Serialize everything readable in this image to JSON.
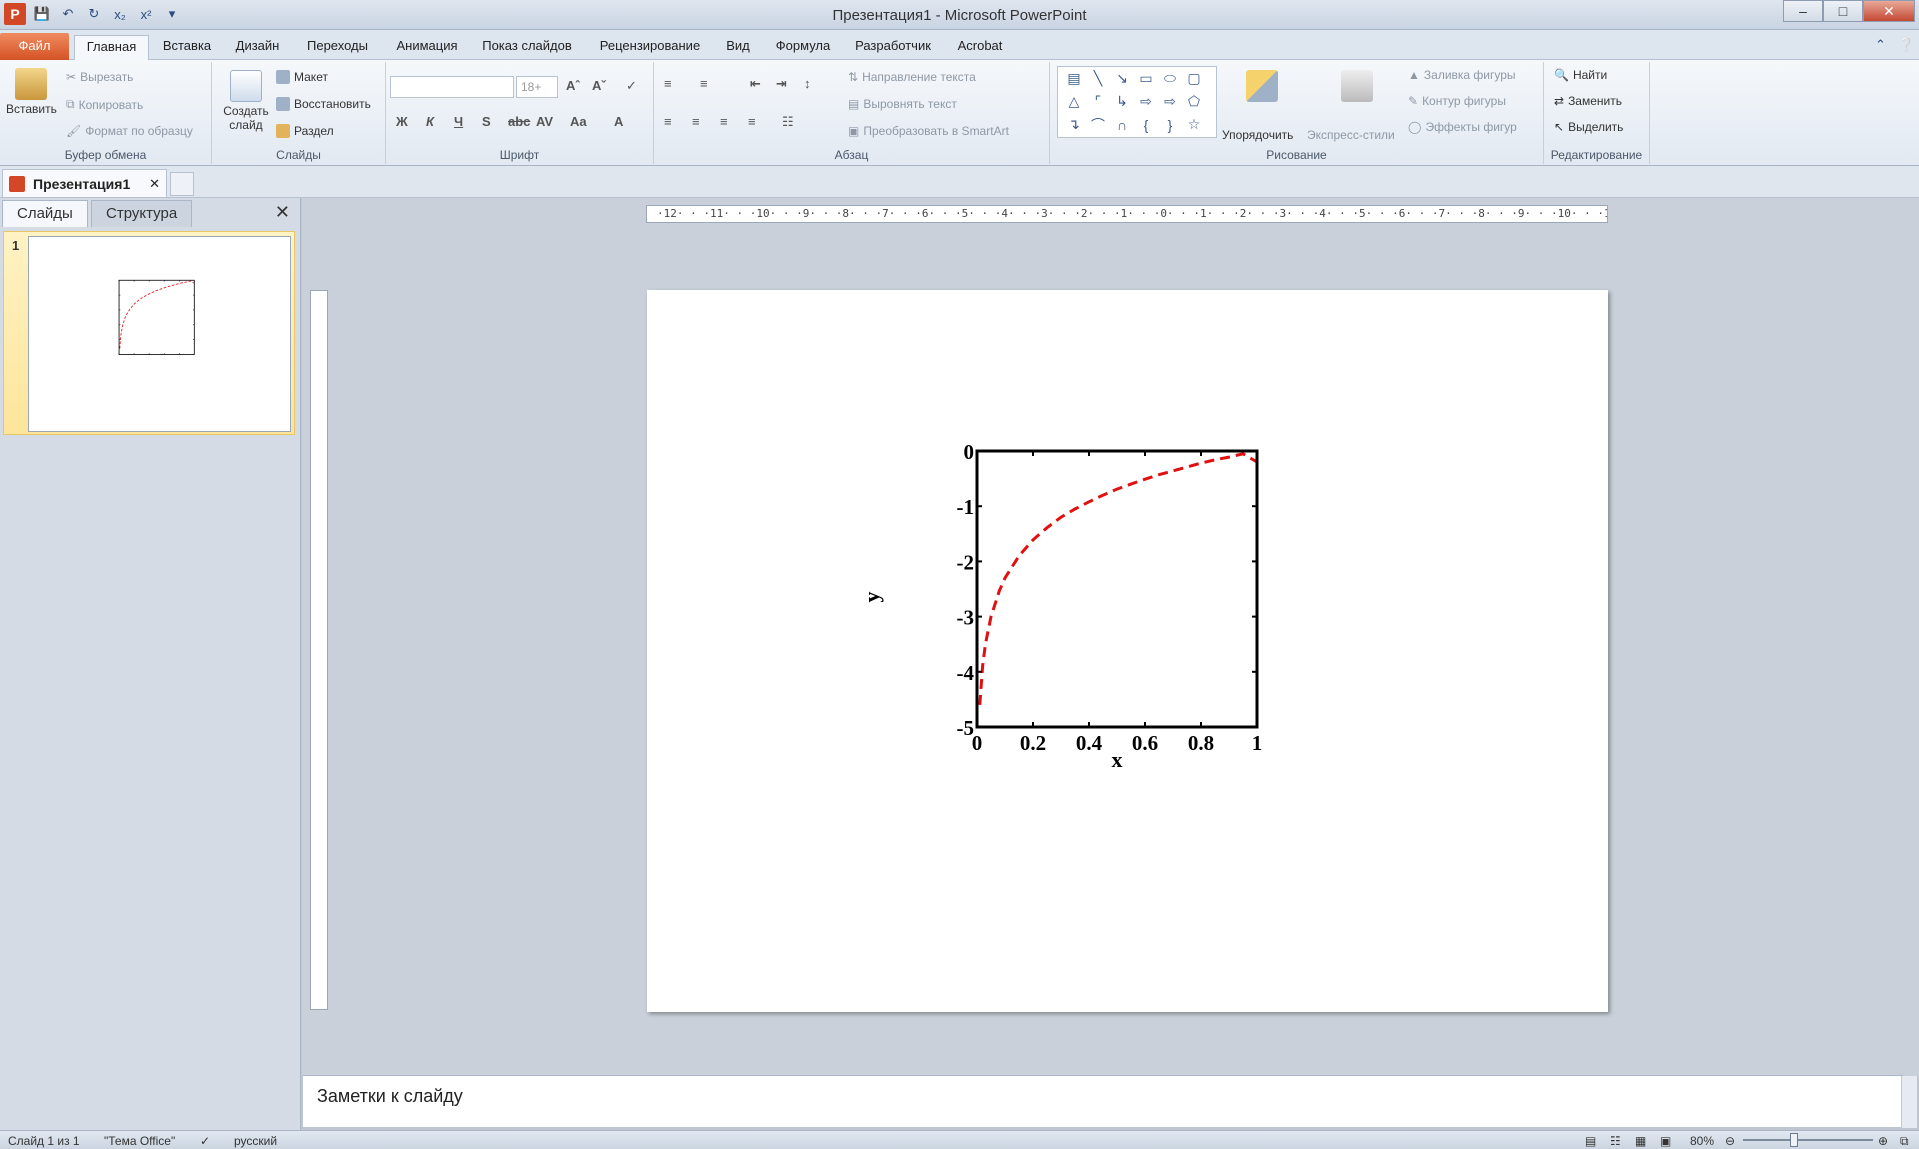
{
  "window": {
    "title": "Презентация1  -  Microsoft PowerPoint"
  },
  "tabs": [
    {
      "label": "Файл"
    },
    {
      "label": "Главная"
    },
    {
      "label": "Вставка"
    },
    {
      "label": "Дизайн"
    },
    {
      "label": "Переходы"
    },
    {
      "label": "Анимация"
    },
    {
      "label": "Показ слайдов"
    },
    {
      "label": "Рецензирование"
    },
    {
      "label": "Вид"
    },
    {
      "label": "Формула"
    },
    {
      "label": "Разработчик"
    },
    {
      "label": "Acrobat"
    }
  ],
  "ribbon": {
    "clipboard": {
      "label": "Буфер обмена",
      "paste": "Вставить",
      "cut": "Вырезать",
      "copy": "Копировать",
      "format": "Формат по образцу"
    },
    "slides": {
      "label": "Слайды",
      "new_slide": "Создать слайд",
      "layout": "Макет",
      "reset": "Восстановить",
      "section": "Раздел"
    },
    "font": {
      "label": "Шрифт",
      "size": "18+"
    },
    "paragraph": {
      "label": "Абзац",
      "text_direction": "Направление текста",
      "align_text": "Выровнять текст",
      "smartart": "Преобразовать в SmartArt"
    },
    "drawing": {
      "label": "Рисование",
      "arrange": "Упорядочить",
      "quick_styles": "Экспресс-стили",
      "fill": "Заливка фигуры",
      "outline": "Контур фигуры",
      "effects": "Эффекты фигур"
    },
    "editing": {
      "label": "Редактирование",
      "find": "Найти",
      "replace": "Заменить",
      "select": "Выделить"
    }
  },
  "document_tab": {
    "name": "Презентация1"
  },
  "left_panel": {
    "tab_slides": "Слайды",
    "tab_outline": "Структура",
    "slide_number": "1"
  },
  "ruler": {
    "horizontal": "·12· · ·11· · ·10· · ·9· · ·8· · ·7· · ·6· · ·5· · ·4· · ·3· · ·2· · ·1· · ·0· · ·1· · ·2· · ·3· · ·4· · ·5· · ·6· · ·7· · ·8· · ·9· · ·10· · ·11· · ·12·"
  },
  "chart_data": {
    "type": "line",
    "xlabel": "x",
    "ylabel": "y",
    "xlim": [
      0,
      1
    ],
    "ylim": [
      -5,
      0
    ],
    "xticks": [
      "0",
      "0.2",
      "0.4",
      "0.6",
      "0.8",
      "1"
    ],
    "yticks": [
      "0",
      "-1",
      "-2",
      "-3",
      "-4",
      "-5"
    ],
    "series": [
      {
        "color": "#e01010",
        "style": "dashed",
        "x": [
          0.01,
          0.02,
          0.03,
          0.05,
          0.08,
          0.1,
          0.15,
          0.2,
          0.25,
          0.3,
          0.35,
          0.4,
          0.45,
          0.5,
          0.55,
          0.6,
          0.65,
          0.7,
          0.75,
          0.8,
          0.85,
          0.9,
          0.95,
          1.0
        ],
        "y": [
          -4.6,
          -3.9,
          -3.5,
          -3.0,
          -2.53,
          -2.3,
          -1.9,
          -1.61,
          -1.39,
          -1.2,
          -1.05,
          -0.92,
          -0.8,
          -0.69,
          -0.6,
          -0.51,
          -0.43,
          -0.36,
          -0.29,
          -0.22,
          -0.16,
          -0.11,
          -0.05,
          -0.2
        ]
      }
    ]
  },
  "notes": {
    "placeholder": "Заметки к слайду"
  },
  "status": {
    "slide": "Слайд 1 из 1",
    "theme": "\"Тема Office\"",
    "language": "русский",
    "zoom": "80%"
  }
}
